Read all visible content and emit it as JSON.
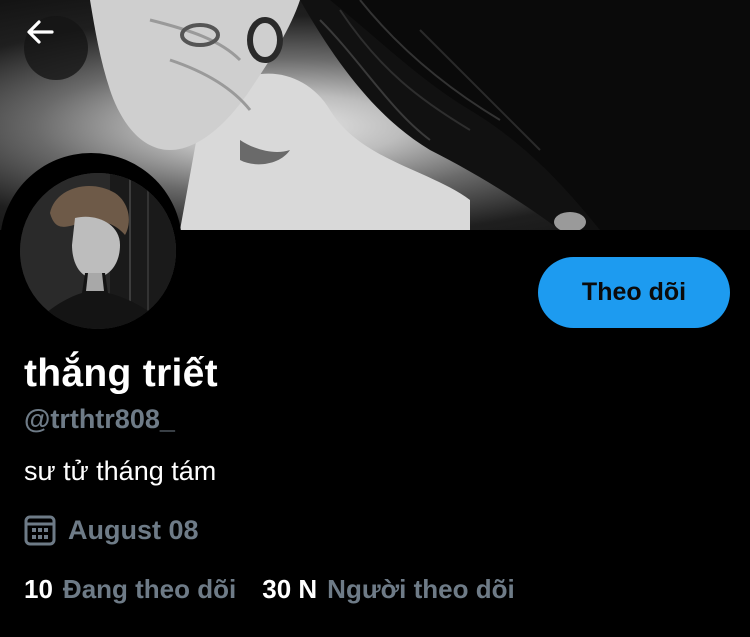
{
  "profile": {
    "display_name": "thắng triết",
    "handle": "@trthtr808_",
    "bio": "sư tử tháng tám",
    "birthday": "August 08"
  },
  "actions": {
    "follow_label": "Theo dõi"
  },
  "stats": {
    "following_count": "10",
    "following_label": "Đang theo dõi",
    "followers_count": "30 N",
    "followers_label": "Người theo dõi"
  },
  "icons": {
    "back": "arrow-left-icon",
    "birthday": "calendar-icon"
  },
  "colors": {
    "accent": "#1d9bf0",
    "muted": "#6e7b87",
    "background": "#000000"
  }
}
